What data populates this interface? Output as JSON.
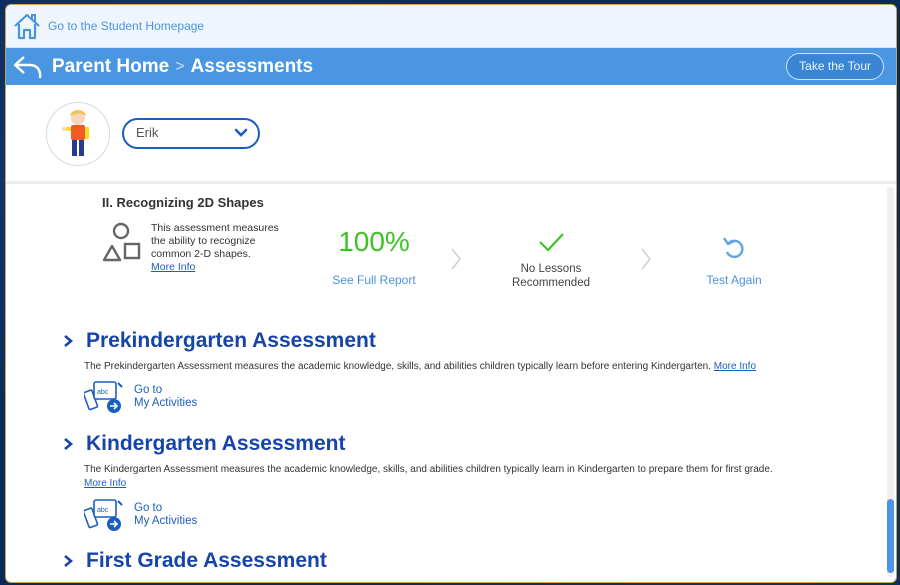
{
  "topbar": {
    "home_link": "Go to the Student Homepage",
    "home_icon": "home-icon"
  },
  "titlebar": {
    "back_icon": "back-arrow-icon",
    "breadcrumb": [
      "Parent Home",
      "Assessments"
    ],
    "separator": ">",
    "tour_button": "Take the Tour"
  },
  "profile": {
    "selected_student": "Erik",
    "avatar": "child-avatar"
  },
  "subassessment": {
    "title": "II. Recognizing 2D Shapes",
    "description": "This assessment measures the ability to recognize common 2-D shapes.",
    "more_info": "More Info",
    "score": "100%",
    "see_report": "See Full Report",
    "recommendation": "No Lessons Recommended",
    "test_again": "Test Again"
  },
  "sections": [
    {
      "title": "Prekindergarten Assessment",
      "description": "The Prekindergarten Assessment measures the academic knowledge, skills, and abilities children typically learn before entering Kindergarten.",
      "more_info": "More Info",
      "activity_line1": "Go to",
      "activity_line2": "My Activities"
    },
    {
      "title": "Kindergarten Assessment",
      "description": "The Kindergarten Assessment measures the academic knowledge, skills, and abilities children typically learn in Kindergarten to prepare them for first grade.",
      "more_info": "More Info",
      "activity_line1": "Go to",
      "activity_line2": "My Activities"
    },
    {
      "title": "First Grade Assessment"
    }
  ],
  "colors": {
    "brand_blue": "#4a96e0",
    "heading_blue": "#1744a8",
    "score_green": "#3cc425",
    "link_blue": "#1a5fbf"
  }
}
